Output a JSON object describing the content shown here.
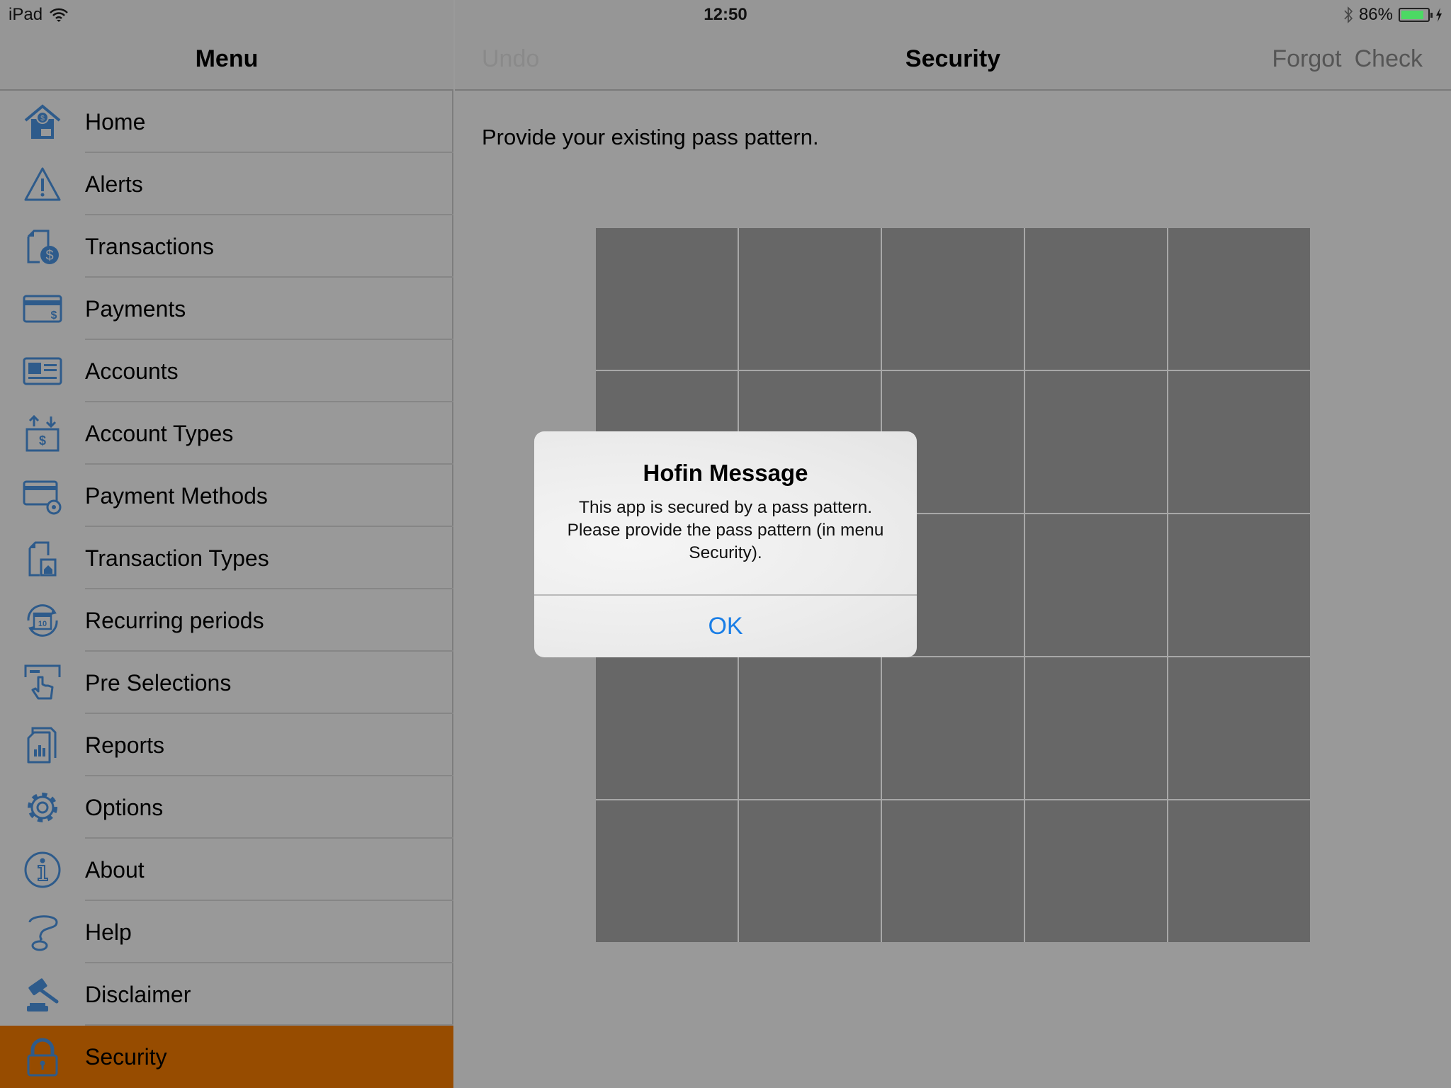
{
  "status_bar": {
    "device": "iPad",
    "wifi_icon": "wifi-icon",
    "time": "12:50",
    "bluetooth_icon": "bluetooth-icon",
    "battery_percent": "86%",
    "battery_level": 0.86,
    "charging_icon": "bolt-icon",
    "battery_color": "#4cd964"
  },
  "sidebar": {
    "title": "Menu",
    "icon_color": "#2e5b8b",
    "active_color": "#974c00",
    "items": [
      {
        "label": "Home",
        "icon": "home-icon"
      },
      {
        "label": "Alerts",
        "icon": "alert-icon"
      },
      {
        "label": "Transactions",
        "icon": "transactions-icon"
      },
      {
        "label": "Payments",
        "icon": "payment-card-icon"
      },
      {
        "label": "Accounts",
        "icon": "accounts-icon"
      },
      {
        "label": "Account Types",
        "icon": "account-types-icon"
      },
      {
        "label": "Payment Methods",
        "icon": "payment-methods-icon"
      },
      {
        "label": "Transaction Types",
        "icon": "transaction-types-icon"
      },
      {
        "label": "Recurring periods",
        "icon": "recurring-calendar-icon"
      },
      {
        "label": "Pre Selections",
        "icon": "pre-selections-icon"
      },
      {
        "label": "Reports",
        "icon": "reports-icon"
      },
      {
        "label": "Options",
        "icon": "gear-icon"
      },
      {
        "label": "About",
        "icon": "info-icon"
      },
      {
        "label": "Help",
        "icon": "help-icon"
      },
      {
        "label": "Disclaimer",
        "icon": "gavel-icon"
      },
      {
        "label": "Security",
        "icon": "lock-icon",
        "active": true
      }
    ]
  },
  "main": {
    "undo_label": "Undo",
    "title": "Security",
    "forgot_label": "Forgot",
    "check_label": "Check",
    "instruction": "Provide your existing pass pattern.",
    "pattern_grid": {
      "rows": 5,
      "cols": 5
    }
  },
  "alert": {
    "title": "Hofin Message",
    "message": "This app is secured by a pass pattern. Please provide the pass pattern (in menu Security).",
    "ok_label": "OK",
    "ok_color": "#1a7ee6"
  }
}
